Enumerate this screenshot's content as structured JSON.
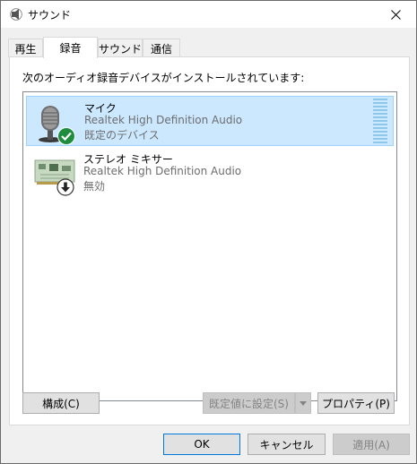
{
  "window": {
    "title": "サウンド",
    "icon": "speaker-icon",
    "close_icon": "close-icon"
  },
  "tabs": [
    {
      "label": "再生",
      "active": false
    },
    {
      "label": "録音",
      "active": true
    },
    {
      "label": "サウンド",
      "active": false
    },
    {
      "label": "通信",
      "active": false
    }
  ],
  "panel": {
    "instruction": "次のオーディオ録音デバイスがインストールされています:"
  },
  "devices": [
    {
      "name": "マイク",
      "driver": "Realtek High Definition Audio",
      "status": "既定のデバイス",
      "icon": "microphone-icon",
      "badge": "default-check-icon",
      "selected": true
    },
    {
      "name": "ステレオ ミキサー",
      "driver": "Realtek High Definition Audio",
      "status": "無効",
      "icon": "sound-card-icon",
      "badge": "disabled-arrow-icon",
      "selected": false
    }
  ],
  "panel_buttons": {
    "configure": "構成(C)",
    "set_default": "既定値に設定(S)",
    "properties": "プロパティ(P)"
  },
  "dialog_buttons": {
    "ok": "OK",
    "cancel": "キャンセル",
    "apply": "適用(A)"
  },
  "colors": {
    "selection_bg": "#cce8ff",
    "selection_border": "#99d1ff",
    "check_green": "#1e8e3e",
    "default_button_border": "#0078d7"
  }
}
